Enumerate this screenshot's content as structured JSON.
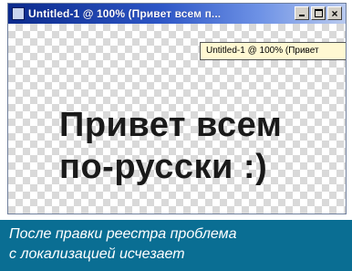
{
  "window": {
    "title": "Untitled-1 @ 100% (Привет всем п...",
    "tooltip": "Untitled-1 @ 100% (Привет",
    "close_glyph": "×"
  },
  "canvas": {
    "line1": "Привет всем",
    "line2": "по-русски :)"
  },
  "caption": {
    "line1": "После правки реестра проблема",
    "line2": "с локализацией исчезает"
  },
  "colors": {
    "titlebar_start": "#0b2a8c",
    "caption_bg": "#0a6e93"
  }
}
